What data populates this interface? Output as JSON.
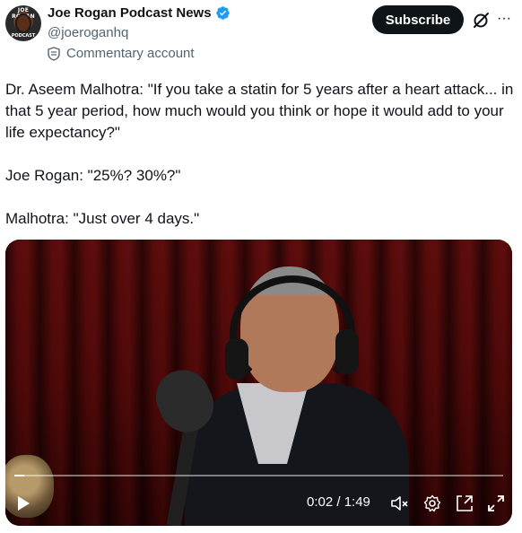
{
  "author": {
    "display_name": "Joe Rogan Podcast News",
    "handle": "@joeroganhq",
    "label": "Commentary account",
    "avatar_text_top": "JOE ROGAN",
    "avatar_text_bottom": "PODCAST"
  },
  "header": {
    "subscribe_label": "Subscribe",
    "more_label": "···"
  },
  "tweet": {
    "paragraphs": [
      "Dr. Aseem Malhotra: \"If you take a statin for 5 years after a heart attack... in that 5 year period, how much would you think or hope it would add to your life expectancy?\"",
      "Joe Rogan: \"25%? 30%?\"",
      "Malhotra: \"Just over 4 days.\""
    ]
  },
  "video": {
    "time_display": "0:02 / 1:49",
    "progress": 0.02
  },
  "colors": {
    "accent": "#1d9bf0",
    "text": "#0f1419",
    "secondary": "#536471",
    "button_bg": "#0f1419"
  }
}
